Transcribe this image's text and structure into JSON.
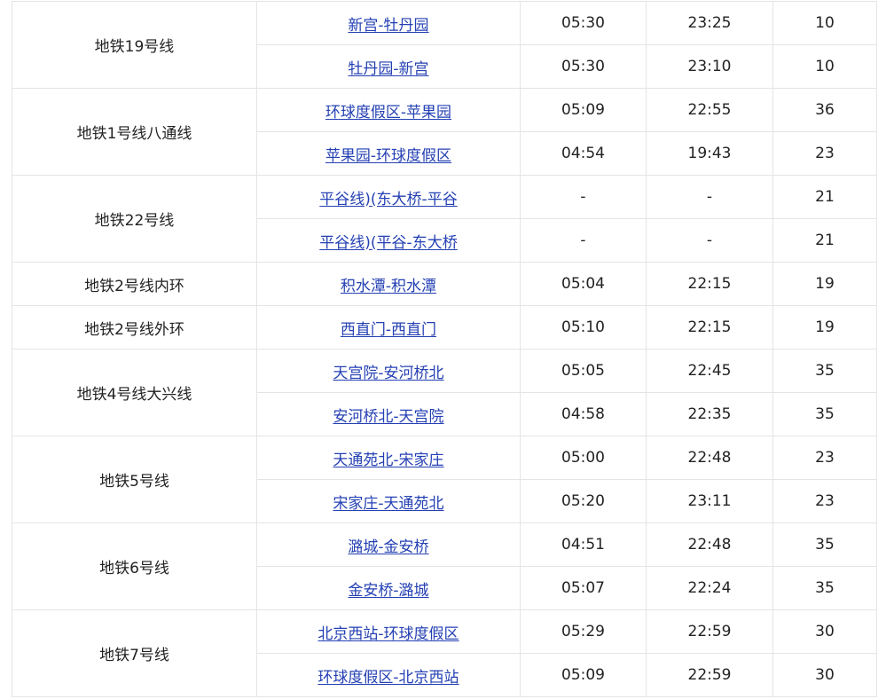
{
  "colors": {
    "link": "#2440b3",
    "text": "#222222",
    "border": "#e4e4e4"
  },
  "lines": [
    {
      "name": "地铁19号线",
      "rows": [
        {
          "direction": "新宫-牡丹园",
          "first": "05:30",
          "last": "23:25",
          "interval": "10"
        },
        {
          "direction": "牡丹园-新宫",
          "first": "05:30",
          "last": "23:10",
          "interval": "10"
        }
      ]
    },
    {
      "name": "地铁1号线八通线",
      "rows": [
        {
          "direction": "环球度假区-苹果园",
          "first": "05:09",
          "last": "22:55",
          "interval": "36"
        },
        {
          "direction": "苹果园-环球度假区",
          "first": "04:54",
          "last": "19:43",
          "interval": "23"
        }
      ]
    },
    {
      "name": "地铁22号线",
      "rows": [
        {
          "direction": "平谷线)(东大桥-平谷",
          "first": "-",
          "last": "-",
          "interval": "21"
        },
        {
          "direction": "平谷线)(平谷-东大桥",
          "first": "-",
          "last": "-",
          "interval": "21"
        }
      ]
    },
    {
      "name": "地铁2号线内环",
      "rows": [
        {
          "direction": "积水潭-积水潭",
          "first": "05:04",
          "last": "22:15",
          "interval": "19"
        }
      ]
    },
    {
      "name": "地铁2号线外环",
      "rows": [
        {
          "direction": "西直门-西直门",
          "first": "05:10",
          "last": "22:15",
          "interval": "19"
        }
      ]
    },
    {
      "name": "地铁4号线大兴线",
      "rows": [
        {
          "direction": "天宫院-安河桥北",
          "first": "05:05",
          "last": "22:45",
          "interval": "35"
        },
        {
          "direction": "安河桥北-天宫院",
          "first": "04:58",
          "last": "22:35",
          "interval": "35"
        }
      ]
    },
    {
      "name": "地铁5号线",
      "rows": [
        {
          "direction": "天通苑北-宋家庄",
          "first": "05:00",
          "last": "22:48",
          "interval": "23"
        },
        {
          "direction": "宋家庄-天通苑北",
          "first": "05:20",
          "last": "23:11",
          "interval": "23"
        }
      ]
    },
    {
      "name": "地铁6号线",
      "rows": [
        {
          "direction": "潞城-金安桥",
          "first": "04:51",
          "last": "22:48",
          "interval": "35"
        },
        {
          "direction": "金安桥-潞城",
          "first": "05:07",
          "last": "22:24",
          "interval": "35"
        }
      ]
    },
    {
      "name": "地铁7号线",
      "rows": [
        {
          "direction": "北京西站-环球度假区",
          "first": "05:29",
          "last": "22:59",
          "interval": "30"
        },
        {
          "direction": "环球度假区-北京西站",
          "first": "05:09",
          "last": "22:59",
          "interval": "30"
        }
      ]
    }
  ]
}
